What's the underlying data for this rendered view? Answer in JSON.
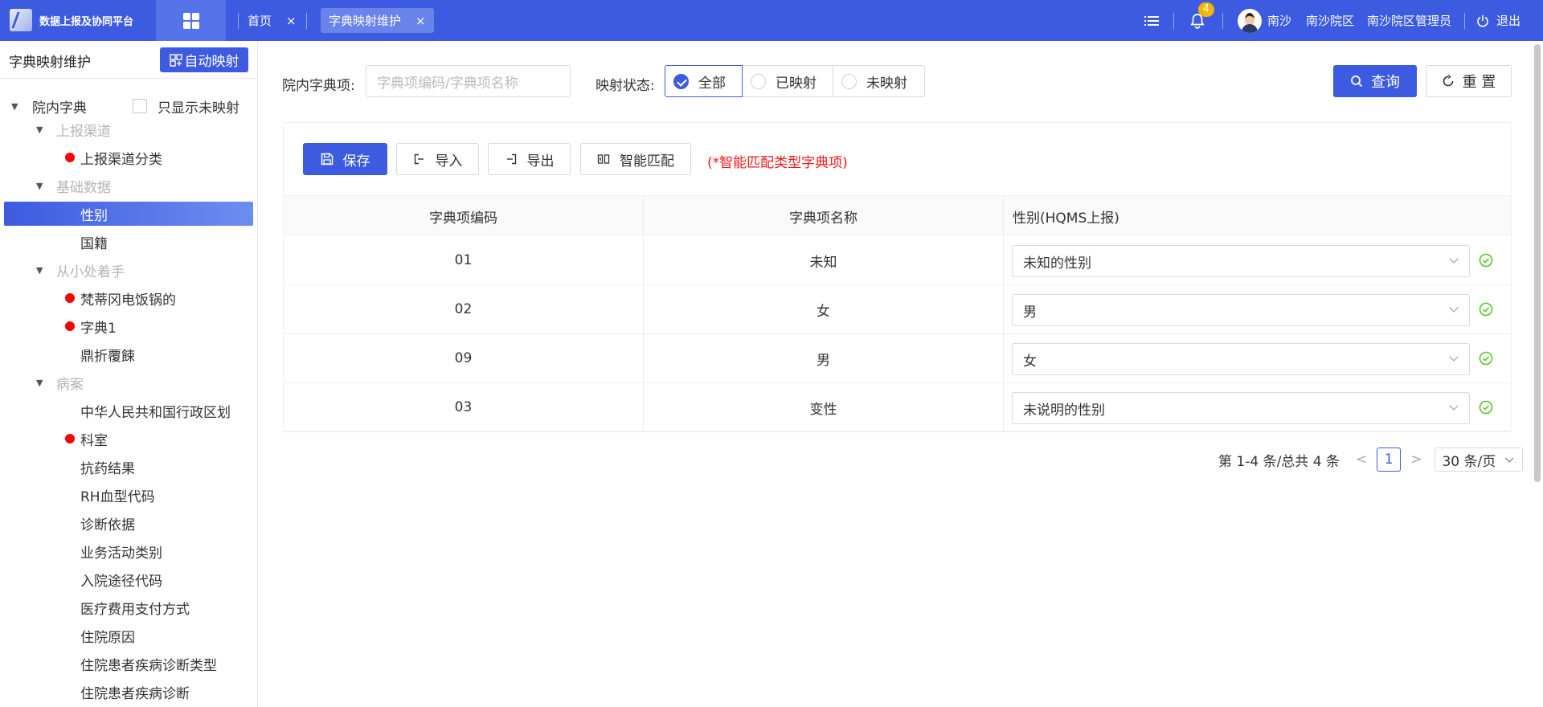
{
  "header": {
    "logo_text": "数据上报及协同平台",
    "tabs": [
      {
        "label": "首页",
        "close": "×"
      },
      {
        "label": "字典映射维护",
        "close": "×"
      }
    ],
    "notification_count": "4",
    "user_name": "南沙",
    "campus": "南沙院区",
    "role": "南沙院区管理员",
    "logout": "退出",
    "accent_color": "#3c5be0"
  },
  "sidebar": {
    "title": "字典映射维护",
    "auto_map_label": "自动映射",
    "root_label": "院内字典",
    "only_unmapped_label": "只显示未映射",
    "tree": [
      {
        "label": "上报渠道",
        "type": "group"
      },
      {
        "label": "上报渠道分类",
        "type": "leaf",
        "dot": true
      },
      {
        "label": "基础数据",
        "type": "group"
      },
      {
        "label": "性别",
        "type": "leaf",
        "selected": true
      },
      {
        "label": "国籍",
        "type": "leaf"
      },
      {
        "label": "从小处着手",
        "type": "group"
      },
      {
        "label": "梵蒂冈电饭锅的",
        "type": "leaf",
        "dot": true
      },
      {
        "label": "字典1",
        "type": "leaf",
        "dot": true
      },
      {
        "label": "鼎折覆餗",
        "type": "leaf"
      },
      {
        "label": "病案",
        "type": "group"
      },
      {
        "label": "中华人民共和国行政区划",
        "type": "leaf"
      },
      {
        "label": "科室",
        "type": "leaf",
        "dot": true
      },
      {
        "label": "抗药结果",
        "type": "leaf"
      },
      {
        "label": "RH血型代码",
        "type": "leaf"
      },
      {
        "label": "诊断依据",
        "type": "leaf"
      },
      {
        "label": "业务活动类别",
        "type": "leaf"
      },
      {
        "label": "入院途径代码",
        "type": "leaf"
      },
      {
        "label": "医疗费用支付方式",
        "type": "leaf"
      },
      {
        "label": "住院原因",
        "type": "leaf"
      },
      {
        "label": "住院患者疾病诊断类型",
        "type": "leaf"
      },
      {
        "label": "住院患者疾病诊断",
        "type": "leaf"
      }
    ]
  },
  "filters": {
    "dict_label": "院内字典项:",
    "dict_placeholder": "字典项编码/字典项名称",
    "status_label": "映射状态:",
    "status_options": [
      "全部",
      "已映射",
      "未映射"
    ],
    "status_selected": "全部",
    "query_label": "查询",
    "reset_label": "重 置"
  },
  "toolbar": {
    "save_label": "保存",
    "import_label": "导入",
    "export_label": "导出",
    "smart_match_label": "智能匹配",
    "note": "(*智能匹配类型字典项)"
  },
  "table": {
    "columns": [
      "字典项编码",
      "字典项名称",
      "性别(HQMS上报)"
    ],
    "rows": [
      {
        "code": "01",
        "name": "未知",
        "mapped": "未知的性别"
      },
      {
        "code": "02",
        "name": "女",
        "mapped": "男"
      },
      {
        "code": "09",
        "name": "男",
        "mapped": "女"
      },
      {
        "code": "03",
        "name": "变性",
        "mapped": "未说明的性别"
      }
    ]
  },
  "pagination": {
    "summary": "第 1-4 条/总共 4 条",
    "prev": "<",
    "current_page": "1",
    "next": ">",
    "page_size": "30 条/页"
  }
}
